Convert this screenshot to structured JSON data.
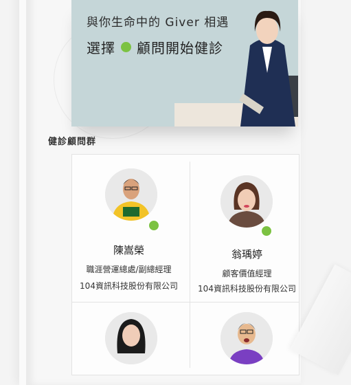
{
  "banner": {
    "line1": "與你生命中的 Giver 相遇",
    "line2_before": "選擇",
    "line2_after": "顧問開始健診",
    "accent_color": "#7cc242"
  },
  "section": {
    "title": "健診顧問群"
  },
  "consultants": [
    {
      "name": "陳嵩榮",
      "title": "職涯營運總處/副總經理",
      "company": "104資訊科技股份有限公司",
      "online": true,
      "shirt_color": "#f2c327"
    },
    {
      "name": "翁瑀婷",
      "title": "顧客價值經理",
      "company": "104資訊科技股份有限公司",
      "online": true,
      "shirt_color": "#6a4c3f"
    },
    {
      "name": "",
      "title": "",
      "company": "",
      "online": false,
      "shirt_color": "#333333"
    },
    {
      "name": "",
      "title": "",
      "company": "",
      "online": false,
      "shirt_color": "#7a3fc2"
    }
  ]
}
